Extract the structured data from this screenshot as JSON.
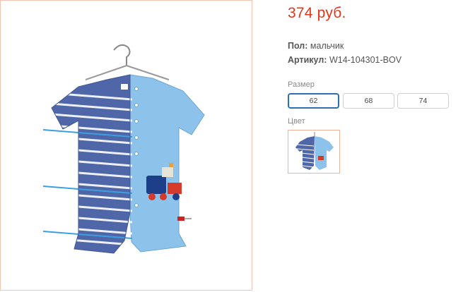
{
  "product": {
    "price": "374 руб.",
    "gender_label": "Пол:",
    "gender_value": "мальчик",
    "article_label": "Артикул:",
    "article_value": "W14-104301-BOV"
  },
  "sizes": {
    "label": "Размер",
    "options": [
      "62",
      "68",
      "74"
    ],
    "selected": "62"
  },
  "colors": {
    "label": "Цвет"
  },
  "theme": {
    "price_color": "#e2361d",
    "selected_border": "#2d6fb1",
    "photo_border": "#f3c7b8"
  }
}
